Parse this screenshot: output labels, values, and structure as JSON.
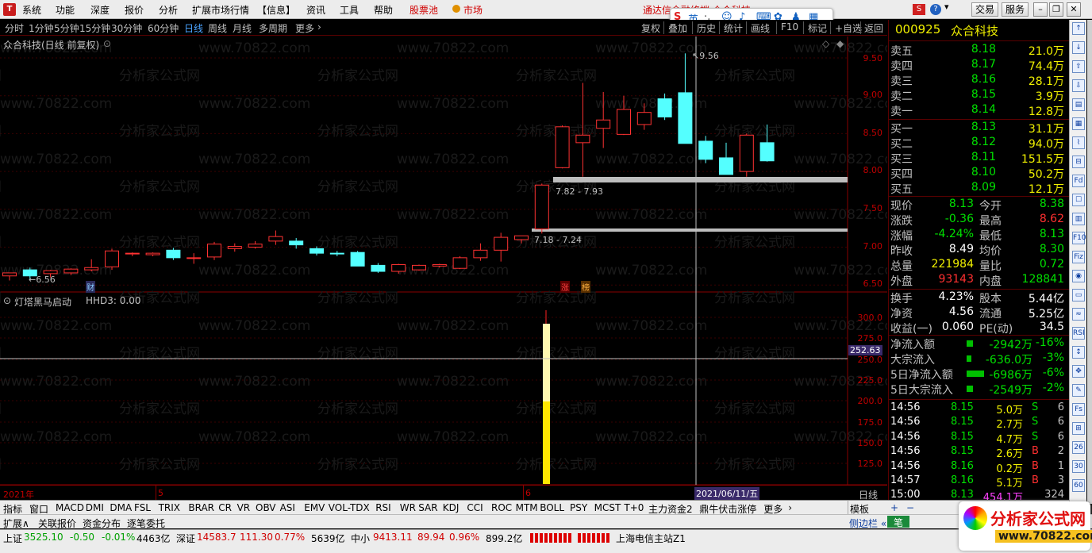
{
  "menubar": {
    "items": [
      "系统",
      "功能",
      "深度",
      "报价",
      "分析",
      "扩展市场行情",
      "【信息】",
      "资讯",
      "工具",
      "帮助"
    ],
    "hot_label": "股票池",
    "market_label": "市场",
    "notice": "通达信金融终端 众合科技",
    "ime_label": "英",
    "buttons": [
      "交易",
      "服务"
    ]
  },
  "periods": {
    "items": [
      "分时",
      "1分钟",
      "5分钟",
      "15分钟",
      "30分钟",
      "60分钟",
      "日线",
      "周线",
      "月线",
      "多周期",
      "更多"
    ],
    "active": "日线"
  },
  "tools": [
    "复权",
    "叠加",
    "历史",
    "统计",
    "画线",
    "F10",
    "标记",
    "+自选",
    "返回"
  ],
  "main": {
    "title": "众合科技(日线 前复权)",
    "y_ticks": [
      "9.50",
      "9.00",
      "8.50",
      "8.00",
      "7.50",
      "7.00",
      "6.50"
    ],
    "high_label": "9.56",
    "low_label": "6.56",
    "zone_upper": "7.82 - 7.93",
    "zone_lower": "7.18 - 7.24",
    "marker_cai": "财",
    "marker_zhang": "涨",
    "marker_bang": "榜"
  },
  "sub": {
    "title": "灯塔黑马启动",
    "value_text": "HHD3: 0.00",
    "y_ticks": [
      "300.0",
      "275.0",
      "250.0",
      "225.0",
      "200.0",
      "175.0",
      "150.0",
      "125.0"
    ],
    "cursor_value": "252.63"
  },
  "xaxis": {
    "labels": [
      "2021年",
      "5",
      "6"
    ],
    "cursor_date": "2021/06/11/五",
    "period_label": "日线"
  },
  "watermark": "www.70822.com",
  "watermark_cn": "分析家公式网",
  "chart_data": {
    "type": "candlestick",
    "series": [
      {
        "o": 6.62,
        "h": 6.66,
        "l": 6.56,
        "c": 6.66
      },
      {
        "o": 6.7,
        "h": 6.73,
        "l": 6.58,
        "c": 6.62
      },
      {
        "o": 6.65,
        "h": 6.7,
        "l": 6.6,
        "c": 6.69
      },
      {
        "o": 6.66,
        "h": 6.72,
        "l": 6.63,
        "c": 6.71
      },
      {
        "o": 6.7,
        "h": 6.84,
        "l": 6.68,
        "c": 6.73
      },
      {
        "o": 6.74,
        "h": 6.98,
        "l": 6.7,
        "c": 6.95
      },
      {
        "o": 6.92,
        "h": 6.93,
        "l": 6.88,
        "c": 6.92
      },
      {
        "o": 6.9,
        "h": 6.93,
        "l": 6.88,
        "c": 6.92
      },
      {
        "o": 6.96,
        "h": 6.99,
        "l": 6.83,
        "c": 6.86
      },
      {
        "o": 6.85,
        "h": 6.92,
        "l": 6.78,
        "c": 6.86
      },
      {
        "o": 6.87,
        "h": 7.07,
        "l": 6.83,
        "c": 7.04
      },
      {
        "o": 6.98,
        "h": 7.05,
        "l": 6.94,
        "c": 7.01
      },
      {
        "o": 7.0,
        "h": 7.08,
        "l": 6.98,
        "c": 7.04
      },
      {
        "o": 7.08,
        "h": 7.22,
        "l": 7.03,
        "c": 7.14
      },
      {
        "o": 7.08,
        "h": 7.12,
        "l": 6.98,
        "c": 7.03
      },
      {
        "o": 6.98,
        "h": 7.01,
        "l": 6.89,
        "c": 6.92
      },
      {
        "o": 6.92,
        "h": 6.95,
        "l": 6.88,
        "c": 6.91
      },
      {
        "o": 6.93,
        "h": 6.95,
        "l": 6.75,
        "c": 6.75
      },
      {
        "o": 6.76,
        "h": 6.79,
        "l": 6.66,
        "c": 6.68
      },
      {
        "o": 6.68,
        "h": 6.78,
        "l": 6.65,
        "c": 6.77
      },
      {
        "o": 6.7,
        "h": 6.77,
        "l": 6.69,
        "c": 6.76
      },
      {
        "o": 6.75,
        "h": 6.78,
        "l": 6.73,
        "c": 6.77
      },
      {
        "o": 6.72,
        "h": 6.88,
        "l": 6.71,
        "c": 6.86
      },
      {
        "o": 6.86,
        "h": 7.05,
        "l": 6.82,
        "c": 6.96
      },
      {
        "o": 6.96,
        "h": 7.19,
        "l": 6.81,
        "c": 7.13
      },
      {
        "o": 7.1,
        "h": 7.15,
        "l": 7.05,
        "c": 7.15
      },
      {
        "o": 7.24,
        "h": 7.84,
        "l": 7.18,
        "c": 7.82
      },
      {
        "o": 8.05,
        "h": 8.61,
        "l": 8.04,
        "c": 8.59
      },
      {
        "o": 8.38,
        "h": 9.17,
        "l": 7.93,
        "c": 8.48
      },
      {
        "o": 8.57,
        "h": 9.05,
        "l": 8.31,
        "c": 8.68
      },
      {
        "o": 8.49,
        "h": 9.0,
        "l": 8.48,
        "c": 8.82
      },
      {
        "o": 8.62,
        "h": 8.9,
        "l": 8.55,
        "c": 8.78
      },
      {
        "o": 8.96,
        "h": 9.03,
        "l": 8.68,
        "c": 8.72
      },
      {
        "o": 9.04,
        "h": 9.56,
        "l": 8.38,
        "c": 8.37
      },
      {
        "o": 8.4,
        "h": 8.47,
        "l": 8.11,
        "c": 8.16
      },
      {
        "o": 8.18,
        "h": 8.38,
        "l": 7.96,
        "c": 7.96
      },
      {
        "o": 8.0,
        "h": 8.5,
        "l": 7.93,
        "c": 8.48
      },
      {
        "o": 8.38,
        "h": 8.62,
        "l": 8.13,
        "c": 8.14
      }
    ]
  },
  "quote": {
    "code": "000925",
    "name": "众合科技",
    "asks": [
      {
        "label": "卖五",
        "price": "8.18",
        "vol": "21.0万"
      },
      {
        "label": "卖四",
        "price": "8.17",
        "vol": "74.4万"
      },
      {
        "label": "卖三",
        "price": "8.16",
        "vol": "28.1万"
      },
      {
        "label": "卖二",
        "price": "8.15",
        "vol": "3.9万"
      },
      {
        "label": "卖一",
        "price": "8.14",
        "vol": "12.8万"
      }
    ],
    "bids": [
      {
        "label": "买一",
        "price": "8.13",
        "vol": "31.1万"
      },
      {
        "label": "买二",
        "price": "8.12",
        "vol": "94.0万"
      },
      {
        "label": "买三",
        "price": "8.11",
        "vol": "151.5万"
      },
      {
        "label": "买四",
        "price": "8.10",
        "vol": "50.2万"
      },
      {
        "label": "买五",
        "price": "8.09",
        "vol": "12.1万"
      }
    ],
    "stats": [
      {
        "l1": "现价",
        "v1": "8.13",
        "l2": "今开",
        "v2": "8.38"
      },
      {
        "l1": "涨跌",
        "v1": "-0.36",
        "l2": "最高",
        "v2": "8.62"
      },
      {
        "l1": "涨幅",
        "v1": "-4.24%",
        "l2": "最低",
        "v2": "8.13"
      },
      {
        "l1": "昨收",
        "v1": "8.49",
        "l2": "均价",
        "v2": "8.30"
      },
      {
        "l1": "总量",
        "v1": "221984",
        "l2": "量比",
        "v2": "0.72"
      },
      {
        "l1": "外盘",
        "v1": "93143",
        "l2": "内盘",
        "v2": "128841"
      }
    ],
    "fund": [
      {
        "l1": "换手",
        "v1": "4.23%",
        "l2": "股本",
        "v2": "5.44亿"
      },
      {
        "l1": "净资",
        "v1": "4.56",
        "l2": "流通",
        "v2": "5.25亿"
      },
      {
        "l1": "收益(一)",
        "v1": "0.060",
        "l2": "PE(动)",
        "v2": "34.5"
      }
    ],
    "flows": [
      {
        "label": "净流入额",
        "value": "-2942万",
        "pct": "-16%"
      },
      {
        "label": "大宗流入",
        "value": "-636.0万",
        "pct": "-3%"
      },
      {
        "label": "5日净流入额",
        "value": "-6986万",
        "pct": "-6%"
      },
      {
        "label": "5日大宗流入",
        "value": "-2549万",
        "pct": "-2%"
      }
    ],
    "ticks": [
      {
        "t": "14:56",
        "p": "8.15",
        "v": "5.0万",
        "d": "S",
        "n": "6"
      },
      {
        "t": "14:56",
        "p": "8.15",
        "v": "2.7万",
        "d": "S",
        "n": "6"
      },
      {
        "t": "14:56",
        "p": "8.15",
        "v": "4.7万",
        "d": "S",
        "n": "6"
      },
      {
        "t": "14:56",
        "p": "8.15",
        "v": "2.6万",
        "d": "B",
        "n": "2"
      },
      {
        "t": "14:56",
        "p": "8.16",
        "v": "0.2万",
        "d": "B",
        "n": "1"
      },
      {
        "t": "14:57",
        "p": "8.16",
        "v": "5.1万",
        "d": "B",
        "n": "3"
      },
      {
        "t": "15:00",
        "p": "8.13",
        "v": "454.1万",
        "d": "",
        "n": "324"
      }
    ]
  },
  "indicators": [
    "指标",
    "窗口",
    "MACD",
    "DMI",
    "DMA",
    "FSL",
    "TRIX",
    "BRAR",
    "CR",
    "VR",
    "OBV",
    "ASI",
    "EMV",
    "VOL-TDX",
    "RSI",
    "WR",
    "SAR",
    "KDJ",
    "CCI",
    "ROC",
    "MTM",
    "BOLL",
    "PSY",
    "MCST",
    "T+0",
    "主力资金2",
    "鼎牛伏击涨停",
    "更多"
  ],
  "ind_right": "模板",
  "bottom_tabs": [
    "扩展∧",
    "关联报价",
    "资金分布",
    "逐笔委托"
  ],
  "side_label": "侧边栏",
  "side_label2": "笔",
  "status": {
    "sh_label": "上证",
    "sh_val": "3525.10",
    "sh_chg": "-0.50",
    "sh_pct": "-0.01%",
    "sh_amt": "4463亿",
    "sz_label": "深证",
    "sz_val": "14583.7",
    "sz_chg": "111.30",
    "sz_pct": "0.77%",
    "sz_amt": "5639亿",
    "zx_label": "中小",
    "zx_val": "9413.11",
    "zx_chg": "89.94",
    "zx_pct": "0.96%",
    "zx_amt": "899.2亿",
    "server": "上海电信主站Z1",
    "logo_cn": "分析家公式网",
    "logo_url": "www.70822.com"
  },
  "right_icons": [
    "↑",
    "↓",
    "⇧",
    "⇩",
    "▤",
    "▦",
    "⌇",
    "⊟",
    "Fd",
    "☐",
    "▥",
    "F10",
    "Fiz",
    "◉",
    "▭",
    "≈",
    "RSI",
    "↕",
    "✥",
    "✎",
    "Fs",
    "⊞",
    "26",
    "30",
    "60"
  ]
}
